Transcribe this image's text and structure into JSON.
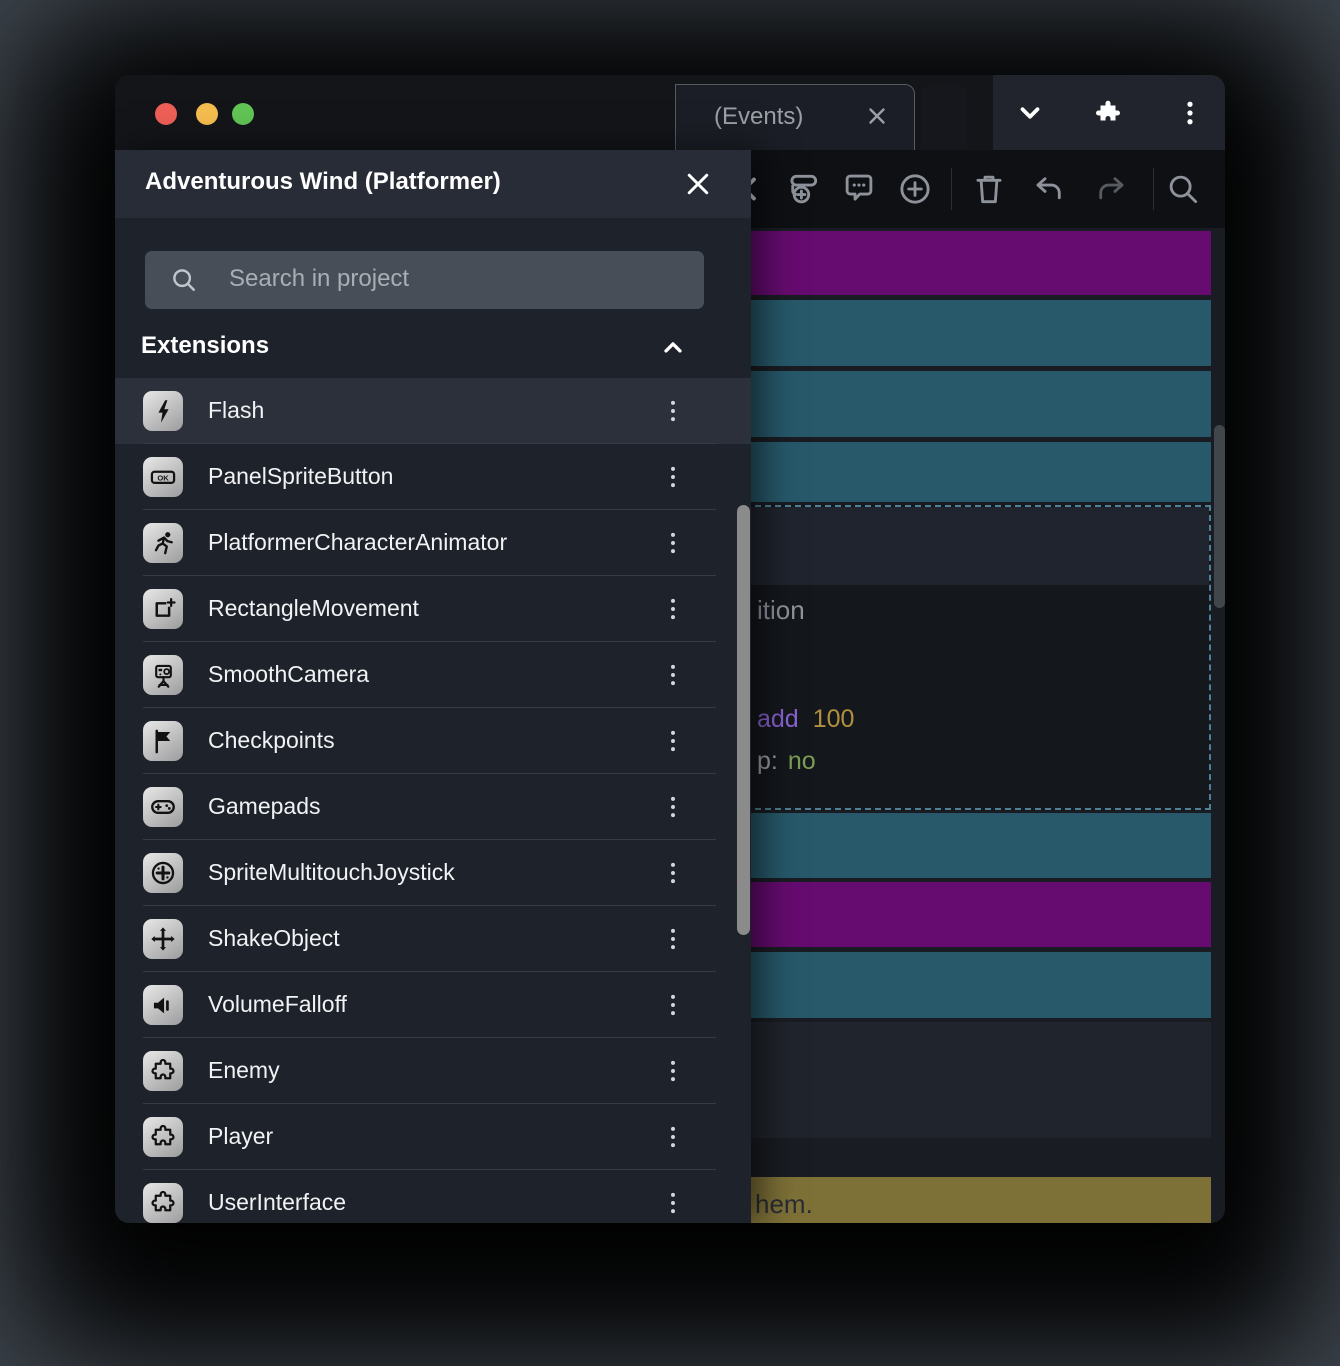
{
  "window": {
    "traffic_lights": {
      "close_color": "#ee5f57",
      "minimize_color": "#f5bd4f",
      "zoom_color": "#61c454"
    }
  },
  "browser": {
    "tab": {
      "label": "(Events)",
      "close_icon": "close-x"
    },
    "controls": {
      "icons": [
        "chevron-down",
        "puzzle-extension",
        "kebab-menu"
      ]
    }
  },
  "toolbar": {
    "icons": [
      "chevron-back",
      "add-sub-event",
      "add-comment",
      "add-event",
      "delete",
      "undo",
      "redo",
      "search"
    ]
  },
  "events": {
    "colors": {
      "purple": "#660b70",
      "teal": "#27596b",
      "olive": "#7e7138",
      "selection_border": "#4f8096"
    },
    "selected_event": {
      "line1": "ition",
      "action_keyword": "add",
      "action_value": "100",
      "prop_label": "p:",
      "prop_value": "no"
    },
    "comment_fragment": "hem."
  },
  "drawer": {
    "title": "Adventurous Wind (Platformer)",
    "close_icon": "close-x",
    "search": {
      "placeholder": "Search in project"
    },
    "section": {
      "label": "Extensions",
      "state_icon": "chevron-up"
    },
    "item_menu_icon": "kebab-menu",
    "items": [
      {
        "label": "Flash",
        "icon": "flash-bolt",
        "highlighted": true
      },
      {
        "label": "PanelSpriteButton",
        "icon": "ok-button",
        "highlighted": false
      },
      {
        "label": "PlatformerCharacterAnimator",
        "icon": "running-character",
        "highlighted": false
      },
      {
        "label": "RectangleMovement",
        "icon": "rectangle-plus",
        "highlighted": false
      },
      {
        "label": "SmoothCamera",
        "icon": "camera-tripod",
        "highlighted": false
      },
      {
        "label": "Checkpoints",
        "icon": "flag",
        "highlighted": false
      },
      {
        "label": "Gamepads",
        "icon": "gamepad",
        "highlighted": false
      },
      {
        "label": "SpriteMultitouchJoystick",
        "icon": "joystick-dpad",
        "highlighted": false
      },
      {
        "label": "ShakeObject",
        "icon": "move-arrows",
        "highlighted": false
      },
      {
        "label": "VolumeFalloff",
        "icon": "speaker",
        "highlighted": false
      },
      {
        "label": "Enemy",
        "icon": "puzzle-piece",
        "highlighted": false
      },
      {
        "label": "Player",
        "icon": "puzzle-piece",
        "highlighted": false
      },
      {
        "label": "UserInterface",
        "icon": "puzzle-piece",
        "highlighted": false
      }
    ]
  }
}
